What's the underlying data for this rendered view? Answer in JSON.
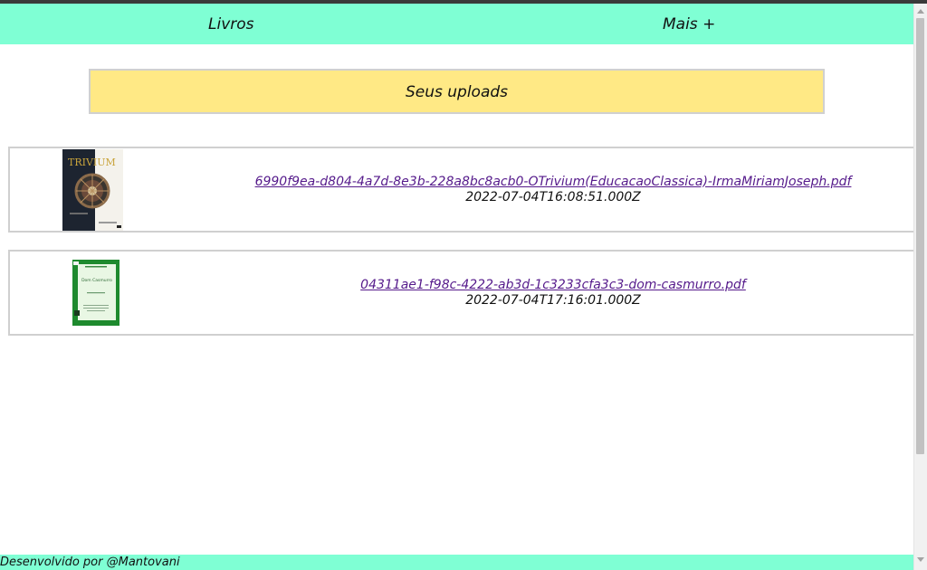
{
  "nav": {
    "books_label": "Livros",
    "more_label": "Mais +"
  },
  "banner": {
    "title": "Seus uploads"
  },
  "uploads": [
    {
      "filename": "6990f9ea-d804-4a7d-8e3b-228a8bc8acb0-OTrivium(EducacaoClassica)-IrmaMiriamJoseph.pdf",
      "date": "2022-07-04T16:08:51.000Z",
      "cover_title": "TRIVIUM",
      "cover_colors": {
        "background": "#1d2430",
        "title": "#c9a43c"
      }
    },
    {
      "filename": "04311ae1-f98c-4222-ab3d-1c3233cfa3c3-dom-casmurro.pdf",
      "date": "2022-07-04T17:16:01.000Z",
      "cover_title": "Dom Casmurro",
      "cover_colors": {
        "frame": "#1e8a2e",
        "page": "#e9f7e4"
      }
    }
  ],
  "footer": {
    "text": "Desenvolvido por @Mantovani"
  },
  "colors": {
    "nav": "#7fffd4",
    "banner": "#ffe985",
    "link": "#551a8b"
  }
}
